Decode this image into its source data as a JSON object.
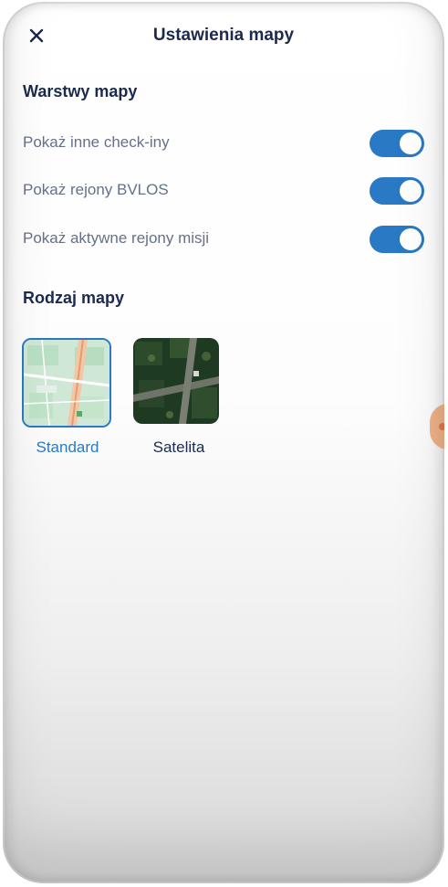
{
  "header": {
    "title": "Ustawienia mapy",
    "close_icon": "close-icon"
  },
  "layers": {
    "title": "Warstwy mapy",
    "items": [
      {
        "label": "Pokaż inne check-iny",
        "enabled": true
      },
      {
        "label": "Pokaż rejony BVLOS",
        "enabled": true
      },
      {
        "label": "Pokaż aktywne rejony misji",
        "enabled": true
      }
    ]
  },
  "map_type": {
    "title": "Rodzaj mapy",
    "options": [
      {
        "label": "Standard",
        "selected": true
      },
      {
        "label": "Satelita",
        "selected": false
      }
    ]
  },
  "colors": {
    "accent": "#2a79c4",
    "heading": "#1d2a4d",
    "label": "#66708a"
  }
}
